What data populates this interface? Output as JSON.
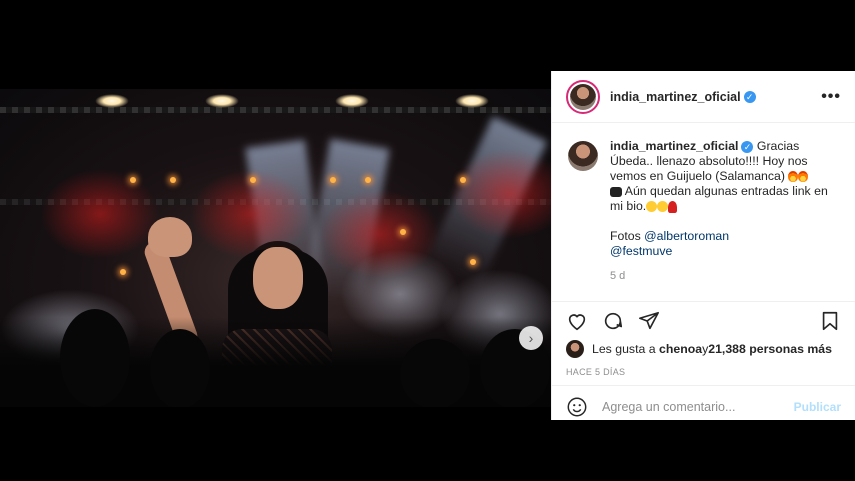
{
  "post": {
    "username": "india_martinez_oficial",
    "verified_glyph": "✓",
    "more_glyph": "•••",
    "carousel_next": "›",
    "carousel_dots": 8,
    "carousel_active_index": 0
  },
  "caption": {
    "username": "india_martinez_oficial",
    "text_part1": " Gracias Úbeda.. llenazo absoluto!!!! Hoy nos vemos en Guijuelo (Salamanca) ",
    "text_part2": " Aún quedan algunas entradas link en mi bio.",
    "photo_credit": "Fotos ",
    "mention1": "@albertoroman",
    "mention2": "@festmuve",
    "relative_time": "5 d"
  },
  "likes": {
    "prefix": "Les gusta a ",
    "first_user": "chenoa",
    "middle": " y ",
    "count_text": "21,388 personas más"
  },
  "timestamp": "HACE 5 DÍAS",
  "comment": {
    "placeholder": "Agrega un comentario...",
    "publish_label": "Publicar"
  },
  "colors": {
    "verified": "#3897f0",
    "link": "#00376b",
    "publish_disabled": "#b2dffc",
    "meta_text": "#8e8e8e"
  }
}
